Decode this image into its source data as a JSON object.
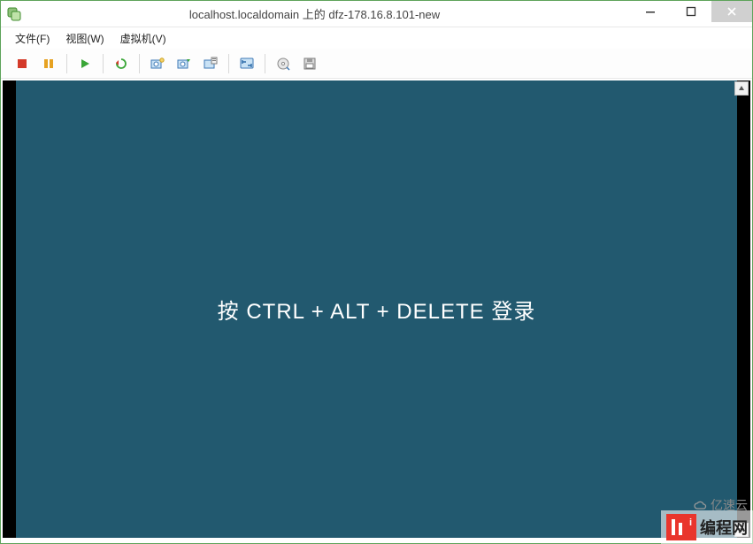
{
  "window": {
    "title": "localhost.localdomain 上的 dfz-178.16.8.101-new"
  },
  "menus": {
    "file": "文件(F)",
    "view": "视图(W)",
    "vm": "虚拟机(V)"
  },
  "toolbar": {
    "poweroff": "power-off",
    "suspend": "suspend",
    "poweron": "power-on",
    "reset": "reset",
    "snapshot": "snapshot",
    "snapshot_manager": "snapshot-manager",
    "revert_snapshot": "revert-snapshot",
    "fullscreen": "fullscreen",
    "connect_cd": "connect-cd",
    "connect_floppy": "connect-floppy"
  },
  "guest": {
    "login_prompt": "按 CTRL + ALT + DELETE 登录"
  },
  "branding": {
    "site_name": "编程网",
    "site_sub": "亿速云"
  }
}
